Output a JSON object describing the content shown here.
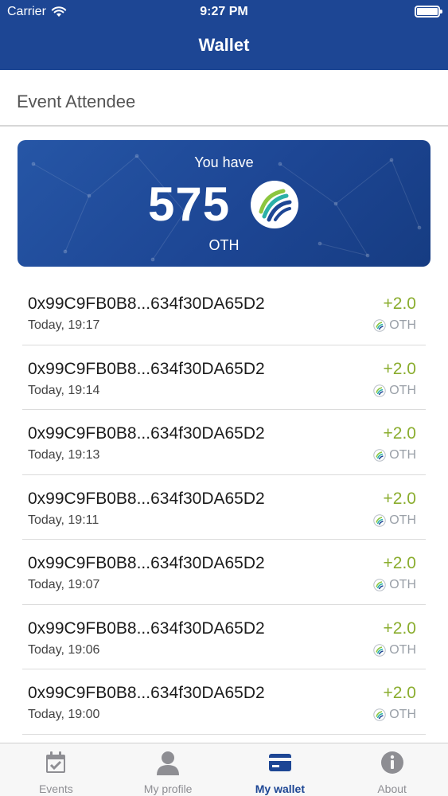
{
  "status_bar": {
    "carrier": "Carrier",
    "time": "9:27 PM"
  },
  "nav": {
    "title": "Wallet"
  },
  "section": {
    "title": "Event Attendee"
  },
  "balance": {
    "label": "You have",
    "amount": "575",
    "unit": "OTH",
    "icon": "oth-logo-icon"
  },
  "transactions": [
    {
      "address": "0x99C9FB0B8...634f30DA65D2",
      "time": "Today, 19:17",
      "amount": "+2.0",
      "currency": "OTH"
    },
    {
      "address": "0x99C9FB0B8...634f30DA65D2",
      "time": "Today, 19:14",
      "amount": "+2.0",
      "currency": "OTH"
    },
    {
      "address": "0x99C9FB0B8...634f30DA65D2",
      "time": "Today, 19:13",
      "amount": "+2.0",
      "currency": "OTH"
    },
    {
      "address": "0x99C9FB0B8...634f30DA65D2",
      "time": "Today, 19:11",
      "amount": "+2.0",
      "currency": "OTH"
    },
    {
      "address": "0x99C9FB0B8...634f30DA65D2",
      "time": "Today, 19:07",
      "amount": "+2.0",
      "currency": "OTH"
    },
    {
      "address": "0x99C9FB0B8...634f30DA65D2",
      "time": "Today, 19:06",
      "amount": "+2.0",
      "currency": "OTH"
    },
    {
      "address": "0x99C9FB0B8...634f30DA65D2",
      "time": "Today, 19:00",
      "amount": "+2.0",
      "currency": "OTH"
    }
  ],
  "tabs": [
    {
      "label": "Events",
      "icon": "calendar-check-icon",
      "active": false
    },
    {
      "label": "My profile",
      "icon": "person-icon",
      "active": false
    },
    {
      "label": "My wallet",
      "icon": "wallet-card-icon",
      "active": true
    },
    {
      "label": "About",
      "icon": "info-icon",
      "active": false
    }
  ],
  "colors": {
    "header": "#1d4694",
    "positive": "#8aad2e",
    "active_tab": "#1d4694",
    "inactive_tab": "#8e8e93"
  }
}
